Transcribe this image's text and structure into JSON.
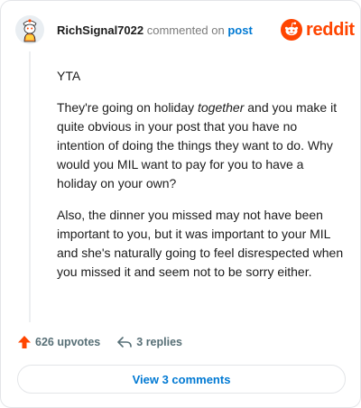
{
  "comment": {
    "username": "RichSignal7022",
    "meta_text": "commented on",
    "post_link": "post",
    "paragraphs": [
      "YTA",
      "They're going on holiday together and you make it quite obvious in your post that you have no intention of doing the things they want to do. Why would you MIL want to pay for you to have a holiday on your own?",
      "Also, the dinner you missed may not have been important to you, but it was important to your MIL and she's naturally going to feel disrespected when you missed it and seem not to be sorry either."
    ],
    "paragraph2_parts": {
      "before": "They're going on holiday ",
      "emphasis": "together",
      "after": " and you make it quite obvious in your post that you have no intention of doing the things they want to do. Why would you MIL want to pay for you to have a holiday on your own?"
    }
  },
  "actions": {
    "upvotes": "626 upvotes",
    "replies": "3 replies"
  },
  "footer": {
    "view_comments": "View 3 comments"
  },
  "brand": {
    "wordmark": "reddit",
    "color": "#ff4500"
  },
  "colors": {
    "link": "#0079d3",
    "upvote": "#ff4500",
    "muted": "#7c7c7c"
  },
  "icons": [
    "avatar",
    "reddit-logo-icon",
    "upvote-arrow-icon",
    "reply-arrow-icon"
  ]
}
